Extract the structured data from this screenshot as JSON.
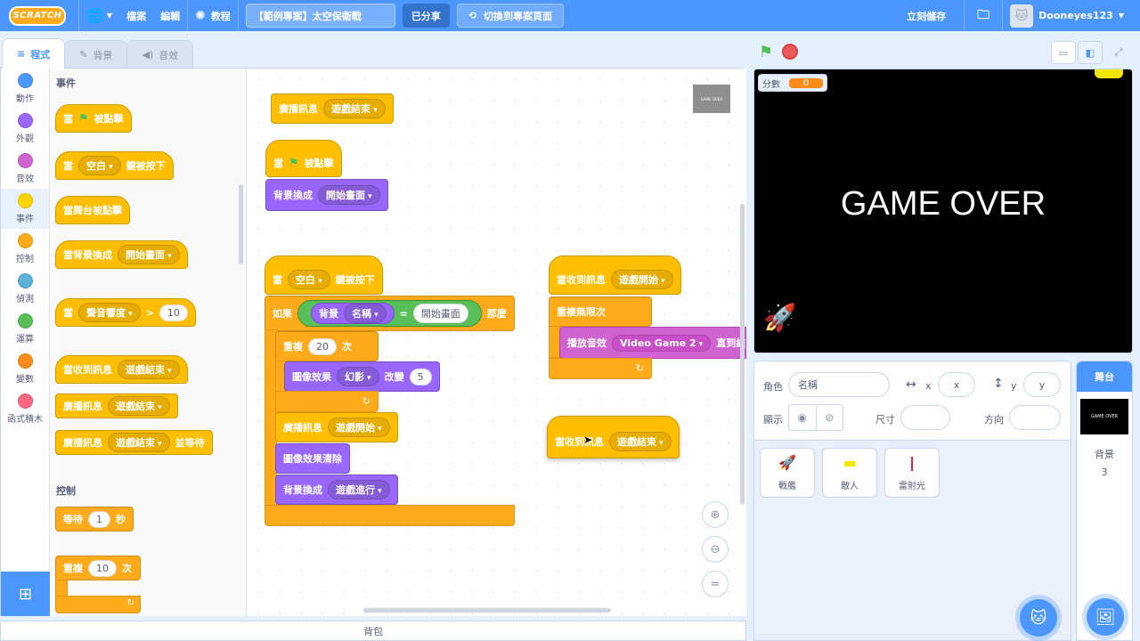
{
  "topbar": {
    "logo": "SCRATCH",
    "globe": "globe-icon",
    "file": "檔案",
    "edit": "編輯",
    "tutorials": "教程",
    "project_title": "【範例專案】太空保衛戰",
    "shared": "已分享",
    "see_project": "切換到專案頁面",
    "save_now": "立刻儲存",
    "username": "Dooneyes123"
  },
  "tabs": {
    "code": "程式",
    "backdrops": "背景",
    "sounds": "音效"
  },
  "categories": [
    {
      "label": "動作",
      "color": "#4c97ff"
    },
    {
      "label": "外觀",
      "color": "#9966ff"
    },
    {
      "label": "音效",
      "color": "#cf63cf"
    },
    {
      "label": "事件",
      "color": "#ffd500"
    },
    {
      "label": "控制",
      "color": "#ffab19"
    },
    {
      "label": "偵測",
      "color": "#5cb1d6"
    },
    {
      "label": "運算",
      "color": "#59c059"
    },
    {
      "label": "變數",
      "color": "#ff8c1a"
    },
    {
      "label": "函式積木",
      "color": "#ff6680"
    }
  ],
  "palette": {
    "events_head": "事件",
    "when_flag_pre": "當",
    "when_flag_post": "被點擊",
    "when_key_pre": "當",
    "when_key_key": "空白",
    "when_key_post": "鍵被按下",
    "when_stage": "當舞台被點擊",
    "when_backdrop": "當背景換成",
    "when_backdrop_val": "開始畫面",
    "when_loud_pre": "當",
    "when_loud_sel": "聲音響度",
    "when_loud_gt": ">",
    "when_loud_val": "10",
    "when_receive": "當收到訊息",
    "when_receive_val": "遊戲結束",
    "broadcast": "廣播訊息",
    "broadcast_val": "遊戲結束",
    "broadcast_wait": "廣播訊息",
    "broadcast_wait_val": "遊戲結束",
    "broadcast_wait_post": "並等待",
    "control_head": "控制",
    "wait_pre": "等待",
    "wait_val": "1",
    "wait_post": "秒",
    "repeat_pre": "重複",
    "repeat_val": "10",
    "repeat_post": "次"
  },
  "scripts": {
    "s1_broadcast": "廣播訊息",
    "s1_val": "遊戲結束",
    "s2_when": "當",
    "s2_clicked": "被點擊",
    "s2_switch": "背景換成",
    "s2_switch_val": "開始畫面",
    "s3_when": "當",
    "s3_key": "空白",
    "s3_pressed": "鍵被按下",
    "s3_if": "如果",
    "s3_backdrop": "背景",
    "s3_name": "名稱",
    "s3_eq": "=",
    "s3_eq_val": "開始畫面",
    "s3_then": "那麼",
    "s3_repeat": "重複",
    "s3_repeat_val": "20",
    "s3_times": "次",
    "s3_effect": "圖像效果",
    "s3_effect_val": "幻影",
    "s3_change": "改變",
    "s3_change_val": "5",
    "s3_broadcast": "廣播訊息",
    "s3_broadcast_val": "遊戲開始",
    "s3_clear": "圖像效果清除",
    "s3_switch": "背景換成",
    "s3_switch_val": "遊戲進行",
    "s4_receive": "當收到訊息",
    "s4_receive_val": "遊戲開始",
    "s4_forever": "重複無限次",
    "s4_play": "播放音效",
    "s4_play_val": "Video Game 2",
    "s4_until": "直到結",
    "s5_receive": "當收到訊息",
    "s5_receive_val": "遊戲結束",
    "thumb": "GAME OVER"
  },
  "backpack": "背包",
  "stage": {
    "monitor_label": "分數",
    "monitor_value": "0",
    "text": "GAME OVER"
  },
  "sprite_info": {
    "sprite_label": "角色",
    "name_placeholder": "名稱",
    "x_label": "x",
    "x_placeholder": "x",
    "y_label": "y",
    "y_placeholder": "y",
    "show_label": "顯示",
    "size_label": "尺寸",
    "direction_label": "方向"
  },
  "sprites": [
    {
      "name": "戰艦",
      "icon": "rocket-icon"
    },
    {
      "name": "敵人",
      "icon": "alien-icon"
    },
    {
      "name": "雷射光",
      "icon": "laser-icon"
    }
  ],
  "stage_panel": {
    "head": "舞台",
    "thumb": "GAME OVER",
    "backdrops_label": "背景",
    "backdrops_count": "3"
  }
}
